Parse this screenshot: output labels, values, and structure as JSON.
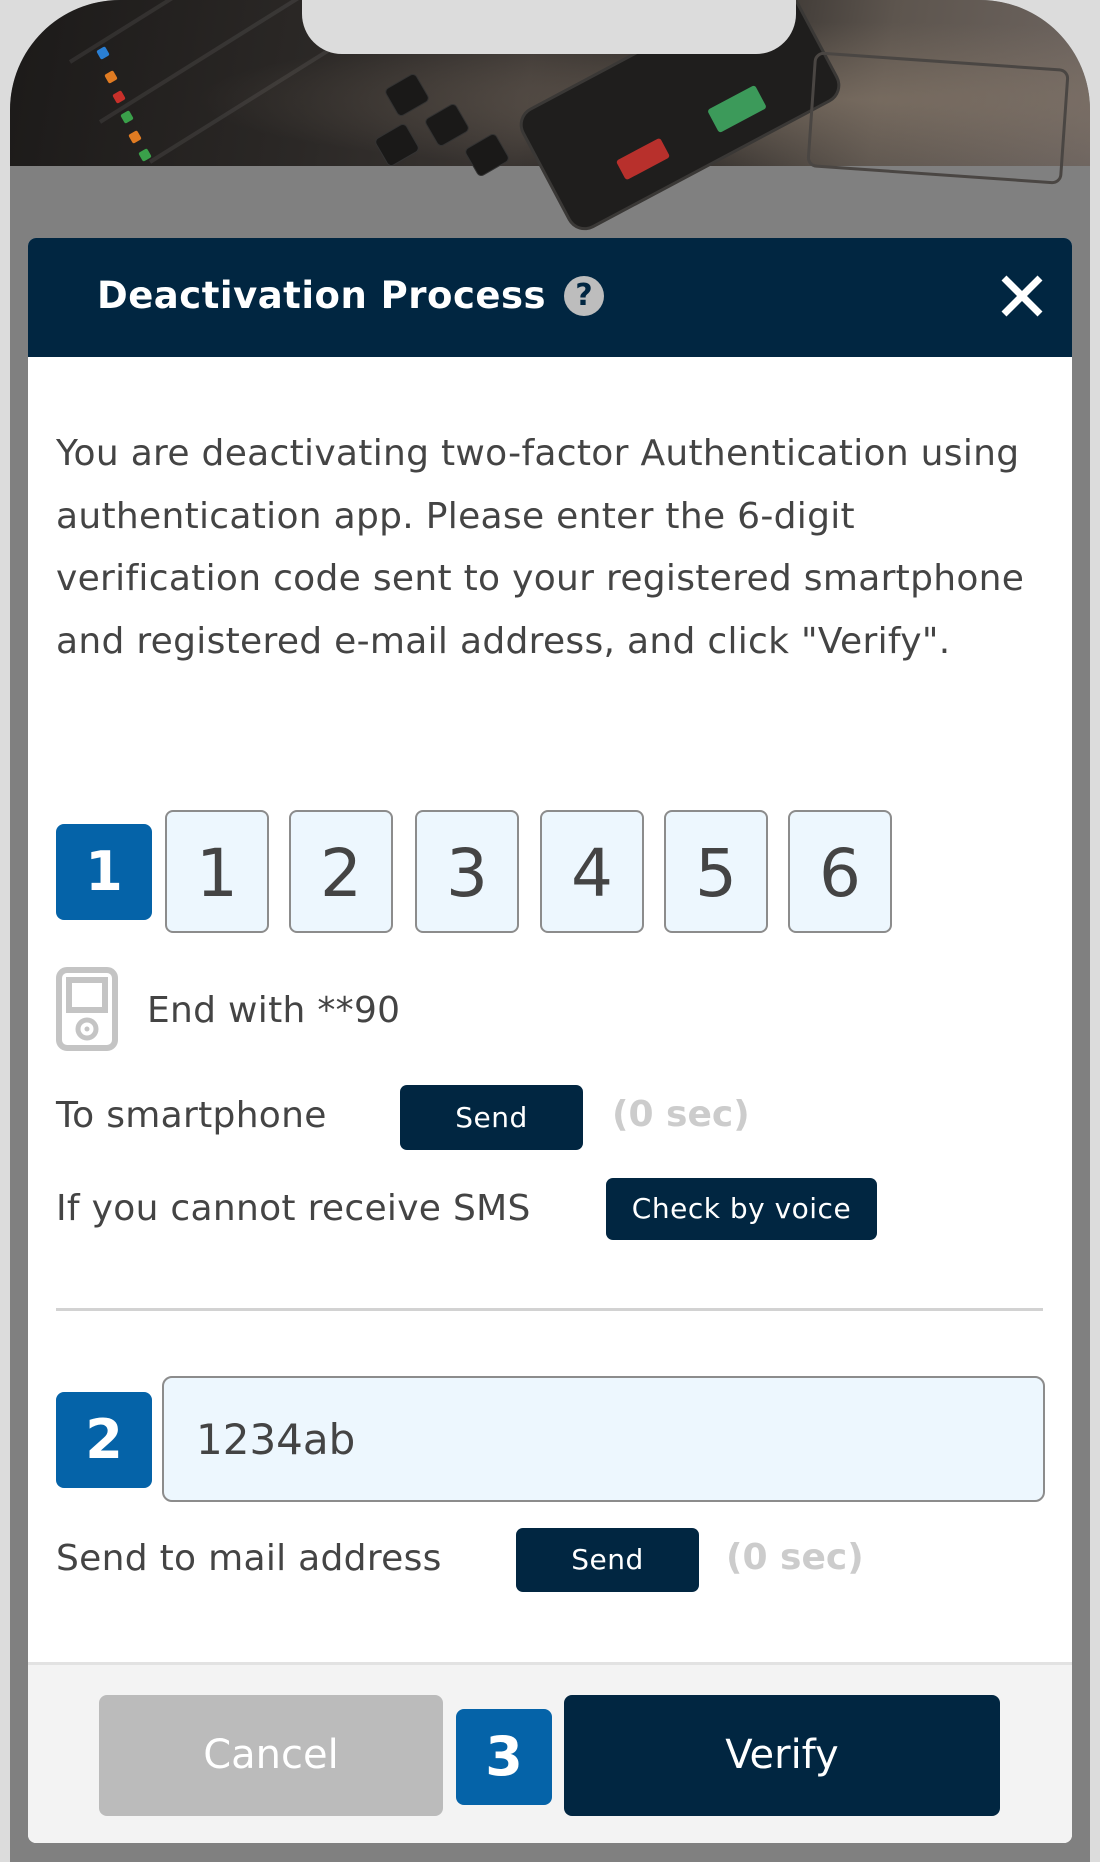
{
  "modal": {
    "title": "Deactivation Process",
    "help_icon": "question-circle-icon",
    "close_icon": "close-x-icon",
    "intro_text": "You are deactivating two-factor Authentication using authentication app. Please enter the 6-digit verification code sent to your registered smartphone and registered e-mail address, and click \"Verify\"."
  },
  "step1": {
    "badge": "1",
    "digits": [
      "1",
      "2",
      "3",
      "4",
      "5",
      "6"
    ],
    "device_icon": "smartphone-icon",
    "phone_hint": "End with **90",
    "smartphone_label": "To smartphone",
    "smartphone_send_label": "Send",
    "smartphone_timer": "(0 sec)",
    "sms_fallback_label": "If you cannot receive SMS",
    "voice_button_label": "Check by voice"
  },
  "step2": {
    "badge": "2",
    "email_code_value": "1234ab",
    "mail_label": "Send to mail address",
    "mail_send_label": "Send",
    "mail_timer": "(0 sec)"
  },
  "footer": {
    "cancel_label": "Cancel",
    "step3_badge": "3",
    "verify_label": "Verify"
  },
  "colors": {
    "header_bg": "#012641",
    "step_badge": "#0563a8",
    "input_bg": "#edf7fe",
    "cancel_bg": "#bbbbbb",
    "timer_text": "#cccccc",
    "overlay": "#808080"
  }
}
